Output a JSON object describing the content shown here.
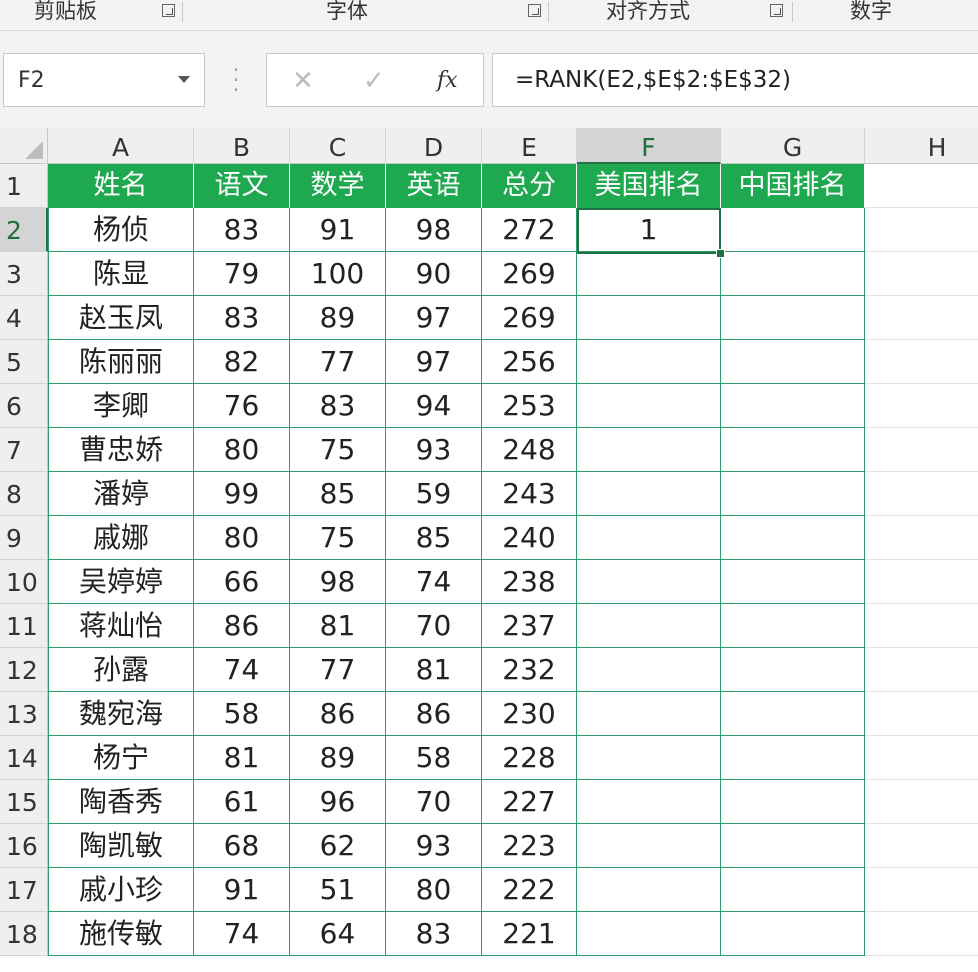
{
  "ribbon": {
    "groups": [
      "剪贴板",
      "字体",
      "对齐方式",
      "数字"
    ]
  },
  "formula_bar": {
    "name_box": "F2",
    "cancel_icon": "x-icon",
    "enter_icon": "check-icon",
    "fx_label": "fx",
    "formula": "=RANK(E2,$E$2:$E$32)"
  },
  "sheet": {
    "columns": [
      "A",
      "B",
      "C",
      "D",
      "E",
      "F",
      "G",
      "H"
    ],
    "selected_cell": "F2",
    "header_row": {
      "row_number": "1",
      "cells": [
        "姓名",
        "语文",
        "数学",
        "英语",
        "总分",
        "美国排名",
        "中国排名"
      ]
    },
    "rows": [
      {
        "num": "2",
        "cells": [
          "杨侦",
          "83",
          "91",
          "98",
          "272",
          "1",
          ""
        ]
      },
      {
        "num": "3",
        "cells": [
          "陈显",
          "79",
          "100",
          "90",
          "269",
          "",
          ""
        ]
      },
      {
        "num": "4",
        "cells": [
          "赵玉凤",
          "83",
          "89",
          "97",
          "269",
          "",
          ""
        ]
      },
      {
        "num": "5",
        "cells": [
          "陈丽丽",
          "82",
          "77",
          "97",
          "256",
          "",
          ""
        ]
      },
      {
        "num": "6",
        "cells": [
          "李卿",
          "76",
          "83",
          "94",
          "253",
          "",
          ""
        ]
      },
      {
        "num": "7",
        "cells": [
          "曹忠娇",
          "80",
          "75",
          "93",
          "248",
          "",
          ""
        ]
      },
      {
        "num": "8",
        "cells": [
          "潘婷",
          "99",
          "85",
          "59",
          "243",
          "",
          ""
        ]
      },
      {
        "num": "9",
        "cells": [
          "戚娜",
          "80",
          "75",
          "85",
          "240",
          "",
          ""
        ]
      },
      {
        "num": "10",
        "cells": [
          "吴婷婷",
          "66",
          "98",
          "74",
          "238",
          "",
          ""
        ]
      },
      {
        "num": "11",
        "cells": [
          "蒋灿怡",
          "86",
          "81",
          "70",
          "237",
          "",
          ""
        ]
      },
      {
        "num": "12",
        "cells": [
          "孙露",
          "74",
          "77",
          "81",
          "232",
          "",
          ""
        ]
      },
      {
        "num": "13",
        "cells": [
          "魏宛海",
          "58",
          "86",
          "86",
          "230",
          "",
          ""
        ]
      },
      {
        "num": "14",
        "cells": [
          "杨宁",
          "81",
          "89",
          "58",
          "228",
          "",
          ""
        ]
      },
      {
        "num": "15",
        "cells": [
          "陶香秀",
          "61",
          "96",
          "70",
          "227",
          "",
          ""
        ]
      },
      {
        "num": "16",
        "cells": [
          "陶凯敏",
          "68",
          "62",
          "93",
          "223",
          "",
          ""
        ]
      },
      {
        "num": "17",
        "cells": [
          "戚小珍",
          "91",
          "51",
          "80",
          "222",
          "",
          ""
        ]
      },
      {
        "num": "18",
        "cells": [
          "施传敏",
          "74",
          "64",
          "83",
          "221",
          "",
          ""
        ]
      }
    ]
  }
}
